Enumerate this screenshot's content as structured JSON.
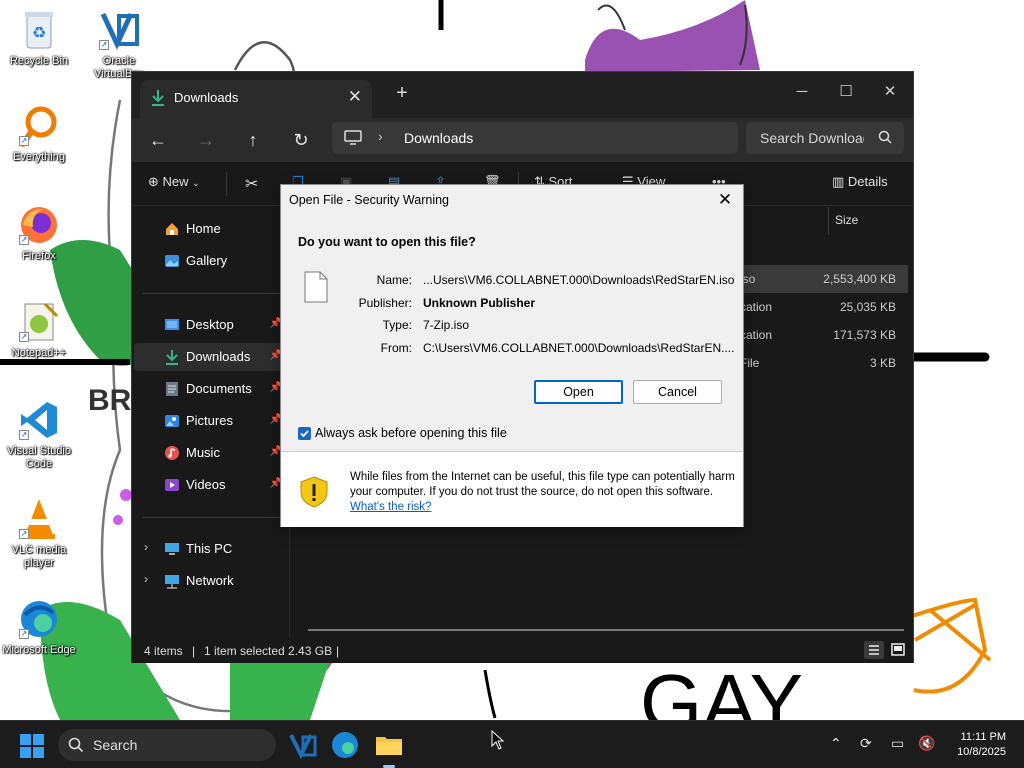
{
  "desktop": {
    "wallpaper_words": {
      "bro": "BRO",
      "gay": "GAY"
    },
    "icons": [
      {
        "label": "Recycle Bin",
        "icon": "recycle-bin-icon"
      },
      {
        "label": "Oracle VirtualBox",
        "icon": "virtualbox-icon"
      },
      {
        "label": "Everything",
        "icon": "everything-search-icon"
      },
      {
        "label": "Firefox",
        "icon": "firefox-icon"
      },
      {
        "label": "Notepad++",
        "icon": "notepadpp-icon"
      },
      {
        "label": "Visual Studio Code",
        "icon": "vscode-icon"
      },
      {
        "label": "VLC media player",
        "icon": "vlc-icon"
      },
      {
        "label": "Microsoft Edge",
        "icon": "edge-icon"
      }
    ]
  },
  "explorer": {
    "tab_title": "Downloads",
    "new_tab": "+",
    "address": {
      "path": "Downloads"
    },
    "search": {
      "placeholder": "Search Downloads"
    },
    "toolbar": {
      "new": "New",
      "sort": "Sort",
      "view": "View",
      "more": "•••",
      "details": "Details"
    },
    "nav": {
      "home": "Home",
      "gallery": "Gallery",
      "desktop": "Desktop",
      "downloads": "Downloads",
      "documents": "Documents",
      "pictures": "Pictures",
      "music": "Music",
      "videos": "Videos",
      "this_pc": "This PC",
      "network": "Network"
    },
    "columns": {
      "size": "Size"
    },
    "files": [
      {
        "type": "iso",
        "size": "2,553,400 KB"
      },
      {
        "type": "cation",
        "size": "25,035 KB"
      },
      {
        "type": "cation",
        "size": "171,573 KB"
      },
      {
        "type": "File",
        "size": "3 KB"
      }
    ],
    "status": {
      "items": "4 items",
      "selected": "1 item selected  2.43 GB"
    }
  },
  "dialog": {
    "title": "Open File - Security Warning",
    "question": "Do you want to open this file?",
    "fields": {
      "name_label": "Name:",
      "name_value": "...Users\\VM6.COLLABNET.000\\Downloads\\RedStarEN.iso",
      "publisher_label": "Publisher:",
      "publisher_value": "Unknown Publisher",
      "type_label": "Type:",
      "type_value": "7-Zip.iso",
      "from_label": "From:",
      "from_value": "C:\\Users\\VM6.COLLABNET.000\\Downloads\\RedStarEN...."
    },
    "open_button": "Open",
    "cancel_button": "Cancel",
    "checkbox_label": "Always ask before opening this file",
    "checkbox_checked": true,
    "warning_text": "While files from the Internet can be useful, this file type can potentially harm your computer. If you do not trust the source, do not open this software.",
    "risk_link": "What's the risk?"
  },
  "taskbar": {
    "search_label": "Search",
    "time": "11:11 PM",
    "date": "10/8/2025"
  }
}
